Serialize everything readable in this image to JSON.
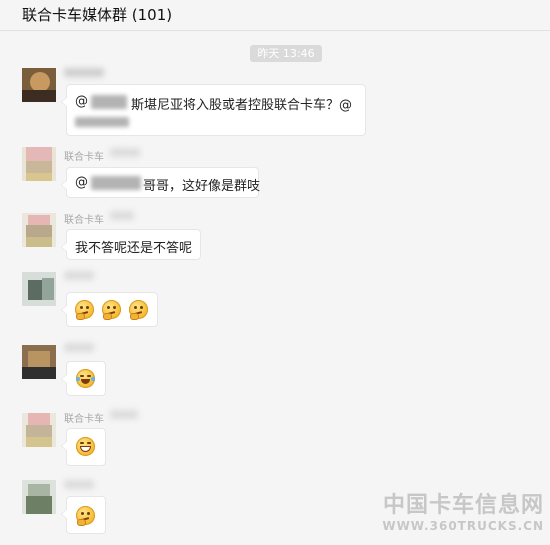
{
  "header": {
    "title": "联合卡车媒体群 (101)"
  },
  "timestamp": "昨天 13:46",
  "messages": [
    {
      "sender": "",
      "text_prefix": "@",
      "text_main": "斯堪尼亚将入股或者控股联合卡车？@",
      "text_line2": ""
    },
    {
      "sender": "联合卡车",
      "text_prefix": "@",
      "text_main": "哥哥，这好像是群吱"
    },
    {
      "sender": "联合卡车",
      "text_main": "我不答呢还是不答呢"
    },
    {
      "sender": "",
      "emojis": [
        "thinking-emoji",
        "thinking-emoji",
        "thinking-emoji"
      ]
    },
    {
      "sender": "",
      "emojis": [
        "laughing-crying-emoji"
      ]
    },
    {
      "sender": "联合卡车",
      "emojis": [
        "grinning-emoji"
      ]
    },
    {
      "sender": "",
      "emojis": [
        "thinking-emoji"
      ]
    }
  ],
  "watermark": {
    "line1": "中国卡车信息网",
    "line2": "WWW.360TRUCKS.CN"
  }
}
